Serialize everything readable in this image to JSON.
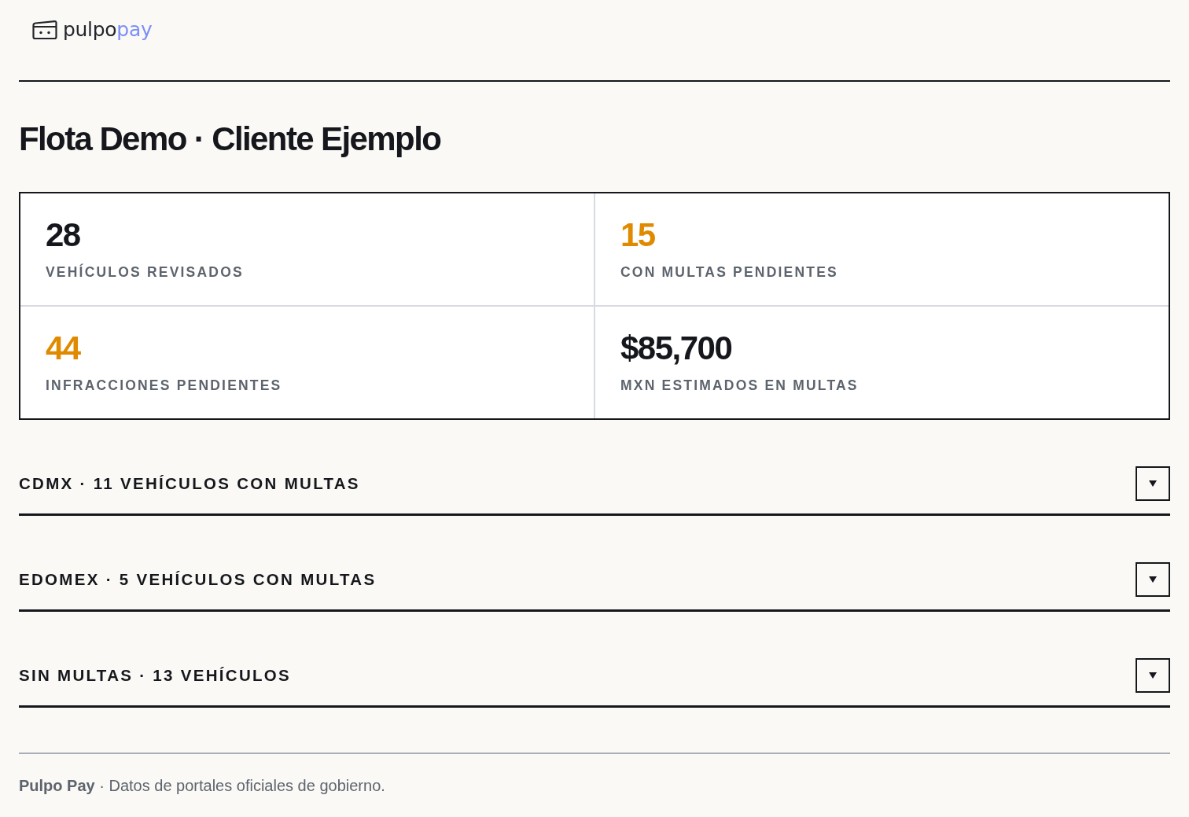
{
  "logo": {
    "wordmark": "pulpo",
    "wordmark_accent": "pay"
  },
  "title": "Flota Demo · Cliente Ejemplo",
  "stats": [
    {
      "value": "28",
      "label": "VEHÍCULOS REVISADOS",
      "highlight": false
    },
    {
      "value": "15",
      "label": "CON MULTAS PENDIENTES",
      "highlight": true
    },
    {
      "value": "44",
      "label": "INFRACCIONES PENDIENTES",
      "highlight": true
    },
    {
      "value": "$85,700",
      "label": "MXN ESTIMADOS EN MULTAS",
      "highlight": false
    }
  ],
  "sections": [
    {
      "label": "CDMX · 11 VEHÍCULOS CON MULTAS",
      "expanded": false
    },
    {
      "label": "EDOMEX · 5 VEHÍCULOS CON MULTAS",
      "expanded": false
    },
    {
      "label": "SIN MULTAS · 13 VEHÍCULOS",
      "expanded": false
    }
  ],
  "footer": {
    "text": "**Pulpo Pay** · Datos de portales oficiales de gobierno."
  }
}
